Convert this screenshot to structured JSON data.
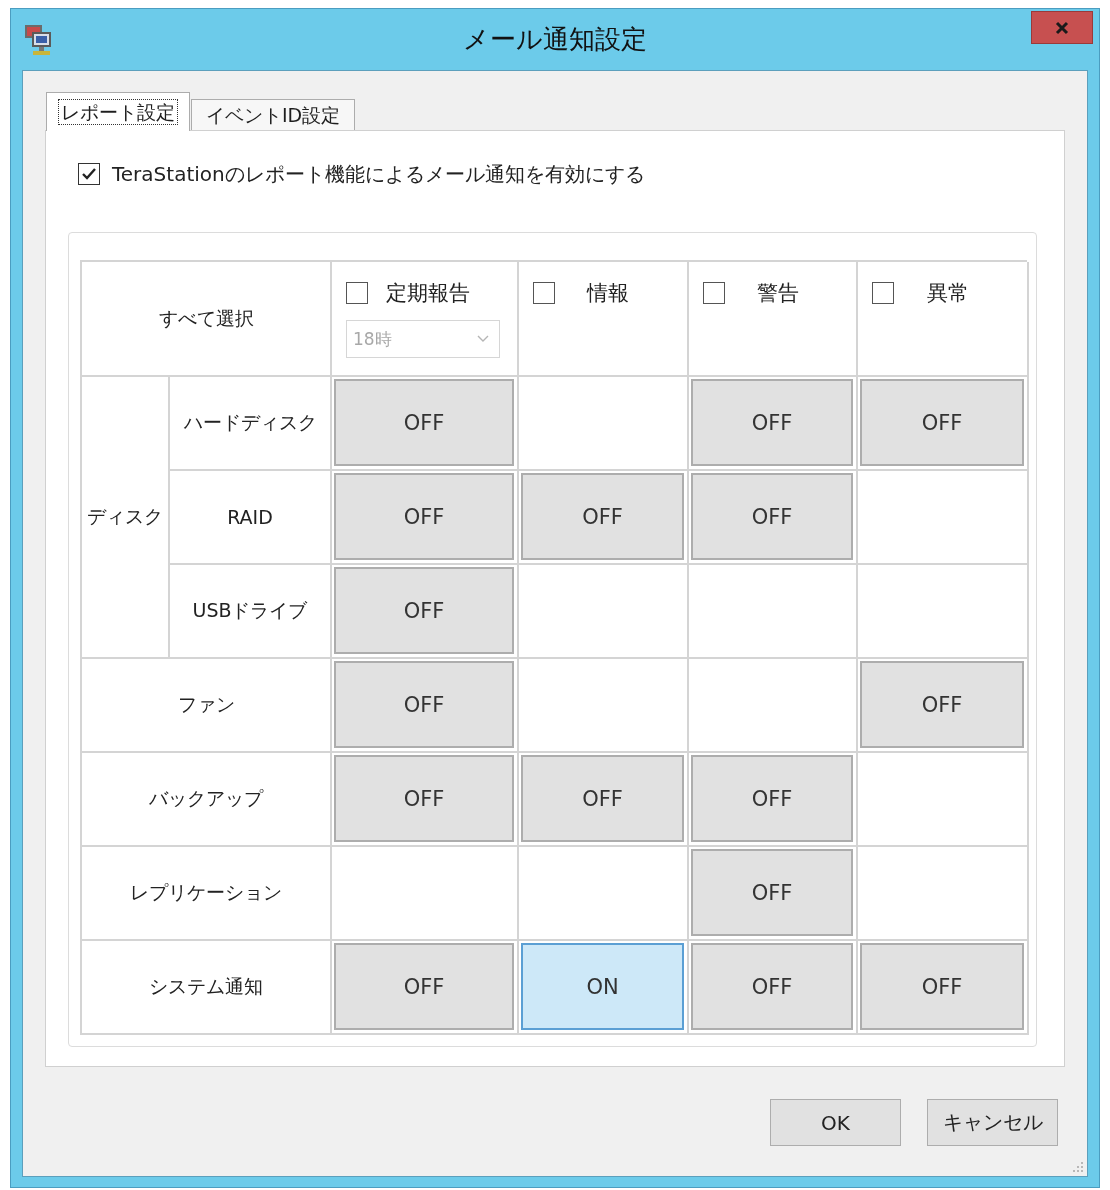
{
  "window": {
    "title": "メール通知設定"
  },
  "tabs": [
    {
      "label": "レポート設定",
      "selected": true
    },
    {
      "label": "イベントID設定",
      "selected": false
    }
  ],
  "enable_report_mail": {
    "label": "TeraStationのレポート機能によるメール通知を有効にする",
    "checked": true
  },
  "table": {
    "select_all": "すべて選択",
    "columns": [
      {
        "label": "定期報告",
        "checked": false,
        "dropdown": {
          "value": "18時",
          "disabled": true
        }
      },
      {
        "label": "情報",
        "checked": false
      },
      {
        "label": "警告",
        "checked": false
      },
      {
        "label": "異常",
        "checked": false
      }
    ],
    "rows": [
      {
        "kind": "group",
        "label": "ディスク",
        "children": [
          {
            "label": "ハードディスク",
            "cells": [
              {
                "text": "OFF",
                "on": false
              },
              null,
              {
                "text": "OFF",
                "on": false
              },
              {
                "text": "OFF",
                "on": false
              }
            ]
          },
          {
            "label": "RAID",
            "cells": [
              {
                "text": "OFF",
                "on": false
              },
              {
                "text": "OFF",
                "on": false
              },
              {
                "text": "OFF",
                "on": false
              },
              null
            ]
          },
          {
            "label": "USBドライブ",
            "cells": [
              {
                "text": "OFF",
                "on": false
              },
              null,
              null,
              null
            ]
          }
        ]
      },
      {
        "kind": "item",
        "label": "ファン",
        "cells": [
          {
            "text": "OFF",
            "on": false
          },
          null,
          null,
          {
            "text": "OFF",
            "on": false
          }
        ]
      },
      {
        "kind": "item",
        "label": "バックアップ",
        "cells": [
          {
            "text": "OFF",
            "on": false
          },
          {
            "text": "OFF",
            "on": false
          },
          {
            "text": "OFF",
            "on": false
          },
          null
        ]
      },
      {
        "kind": "item",
        "label": "レプリケーション",
        "cells": [
          null,
          null,
          {
            "text": "OFF",
            "on": false
          },
          null
        ]
      },
      {
        "kind": "item",
        "label": "システム通知",
        "cells": [
          {
            "text": "OFF",
            "on": false
          },
          {
            "text": "ON",
            "on": true
          },
          {
            "text": "OFF",
            "on": false
          },
          {
            "text": "OFF",
            "on": false
          }
        ]
      }
    ]
  },
  "buttons": [
    "OK",
    "キャンセル"
  ]
}
